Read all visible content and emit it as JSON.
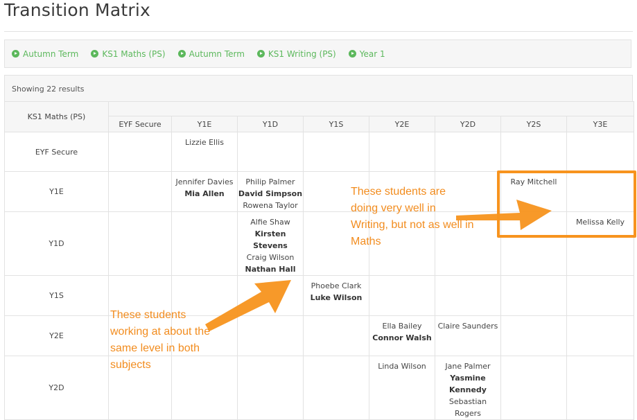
{
  "page": {
    "title": "Transition Matrix"
  },
  "breadcrumbs": [
    {
      "label": "Autumn Term",
      "icon": "play-circle-icon"
    },
    {
      "label": "KS1 Maths (PS)",
      "icon": "play-circle-icon"
    },
    {
      "label": "Autumn Term",
      "icon": "play-circle-icon"
    },
    {
      "label": "KS1 Writing (PS)",
      "icon": "play-circle-icon"
    },
    {
      "label": "Year 1",
      "icon": "play-circle-icon"
    }
  ],
  "results": {
    "text": "Showing 22 results"
  },
  "matrix": {
    "corner_label": "KS1 Maths (PS)",
    "columns": [
      "EYF Secure",
      "Y1E",
      "Y1D",
      "Y1S",
      "Y2E",
      "Y2D",
      "Y2S",
      "Y3E"
    ],
    "rows": [
      {
        "label": "EYF Secure",
        "cells": [
          [],
          [
            {
              "n": "Lizzie Ellis",
              "b": false
            }
          ],
          [],
          [],
          [],
          [],
          [],
          []
        ]
      },
      {
        "label": "Y1E",
        "cells": [
          [],
          [
            {
              "n": "Jennifer Davies",
              "b": false
            },
            {
              "n": "Mia Allen",
              "b": true
            }
          ],
          [
            {
              "n": "Philip Palmer",
              "b": false
            },
            {
              "n": "David Simpson",
              "b": true
            },
            {
              "n": "Rowena Taylor",
              "b": false
            }
          ],
          [],
          [],
          [],
          [
            {
              "n": "Ray Mitchell",
              "b": false
            }
          ],
          []
        ]
      },
      {
        "label": "Y1D",
        "cells": [
          [],
          [],
          [
            {
              "n": "Alfie Shaw",
              "b": false
            },
            {
              "n": "Kirsten Stevens",
              "b": true
            },
            {
              "n": "Craig Wilson",
              "b": false
            },
            {
              "n": "Nathan Hall",
              "b": true
            }
          ],
          [],
          [],
          [],
          [],
          [
            {
              "n": "Melissa Kelly",
              "b": false
            }
          ]
        ]
      },
      {
        "label": "Y1S",
        "cells": [
          [],
          [],
          [],
          [
            {
              "n": "Phoebe Clark",
              "b": false
            },
            {
              "n": "Luke Wilson",
              "b": true
            }
          ],
          [],
          [],
          [],
          []
        ]
      },
      {
        "label": "Y2E",
        "cells": [
          [],
          [],
          [],
          [],
          [
            {
              "n": "Ella Bailey",
              "b": false
            },
            {
              "n": "Connor Walsh",
              "b": true
            }
          ],
          [
            {
              "n": "Claire Saunders",
              "b": false
            }
          ],
          [],
          []
        ]
      },
      {
        "label": "Y2D",
        "cells": [
          [],
          [],
          [],
          [],
          [
            {
              "n": "Linda Wilson",
              "b": false
            }
          ],
          [
            {
              "n": "Jane Palmer",
              "b": false
            },
            {
              "n": "Yasmine Kennedy",
              "b": true
            },
            {
              "n": "Sebastian Rogers",
              "b": false
            }
          ],
          [],
          []
        ]
      }
    ]
  },
  "annotations": {
    "right_note": "These students are doing very well in Writing, but not as well in Maths",
    "left_note": "These students working at about the same level in both subjects",
    "accent_color": "#f7931e"
  }
}
